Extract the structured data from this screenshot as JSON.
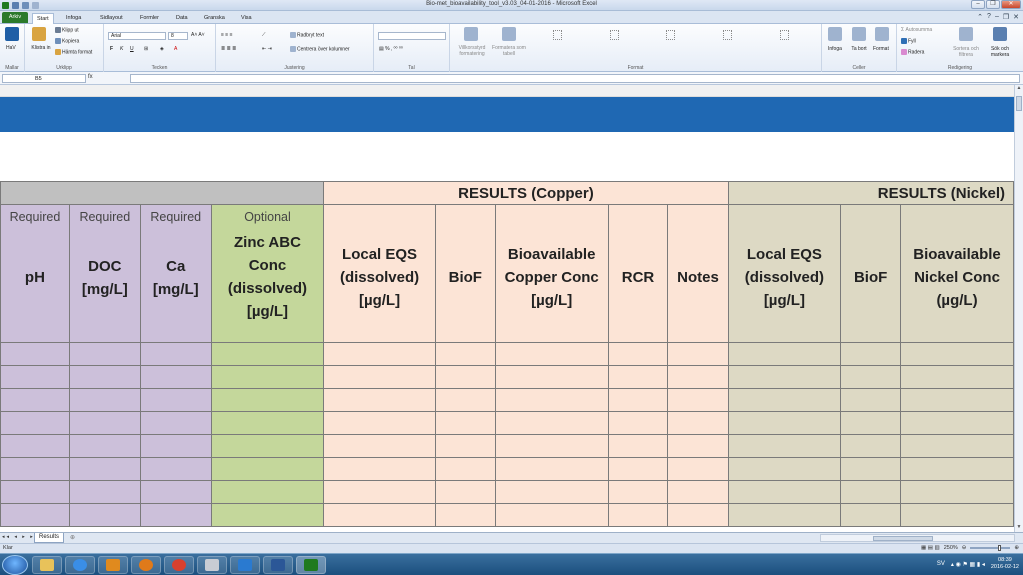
{
  "window": {
    "title": "Bio-met_bioavailability_tool_v3.03_04-01-2016 - Microsoft Excel"
  },
  "tabs": [
    {
      "label": "Arkiv"
    },
    {
      "label": "Start"
    },
    {
      "label": "Infoga"
    },
    {
      "label": "Sidlayout"
    },
    {
      "label": "Formler"
    },
    {
      "label": "Data"
    },
    {
      "label": "Granska"
    },
    {
      "label": "Visa"
    }
  ],
  "ribbon": {
    "mallar": {
      "label": "Mallar",
      "hav": "HaV"
    },
    "urklipp": {
      "label": "Urklipp",
      "klistra": "Klistra in",
      "klipp": "Klipp ut",
      "kopiera": "Kopiera",
      "hamta": "Hämta format"
    },
    "tecken": {
      "label": "Tecken",
      "font": "Arial",
      "size": "8"
    },
    "justering": {
      "label": "Justering",
      "radbryt": "Radbryt text",
      "centrera": "Centrera över kolumner"
    },
    "tal": {
      "label": "Tal"
    },
    "format_group": {
      "label": "Format",
      "villkor": "Villkorsstyrd formatering",
      "tabell": "Formatera som tabell"
    },
    "celler": {
      "label": "Celler",
      "infoga": "Infoga",
      "ta_bort": "Ta bort",
      "format": "Format"
    },
    "redigering": {
      "label": "Redigering",
      "autosumma": "Autosumma",
      "fyll": "Fyll",
      "radera": "Radera",
      "sortera": "Sortera och filtrera",
      "sok": "Sök och markera"
    }
  },
  "formula_bar": {
    "cell_ref": "B5",
    "fx": "fx",
    "value": ""
  },
  "sheet": {
    "group_headers": {
      "copper": "RESULTS (Copper)",
      "nickel": "RESULTS (Nickel)"
    },
    "columns": [
      {
        "tag": "Required",
        "header": "pH",
        "color": "purple"
      },
      {
        "tag": "Required",
        "header": "DOC\n[mg/L]",
        "color": "purple"
      },
      {
        "tag": "Required",
        "header": "Ca\n[mg/L]",
        "color": "purple"
      },
      {
        "tag": "Optional",
        "header": "Zinc ABC\nConc\n(dissolved)\n[µg/L]",
        "color": "green"
      },
      {
        "tag": "",
        "header": "Local EQS\n(dissolved)\n[µg/L]",
        "color": "peach"
      },
      {
        "tag": "",
        "header": "BioF",
        "color": "peach"
      },
      {
        "tag": "",
        "header": "Bioavailable\nCopper Conc\n[µg/L]",
        "color": "peach"
      },
      {
        "tag": "",
        "header": "RCR",
        "color": "peach"
      },
      {
        "tag": "",
        "header": "Notes",
        "color": "peach"
      },
      {
        "tag": "",
        "header": "Local EQS\n(dissolved)\n[µg/L]",
        "color": "tan"
      },
      {
        "tag": "",
        "header": "BioF",
        "color": "tan"
      },
      {
        "tag": "",
        "header": "Bioavailable\nNickel Conc\n(µg/L)",
        "color": "tan"
      }
    ],
    "data_rows": 8
  },
  "sheet_tabs": [
    {
      "label": "Results"
    }
  ],
  "status": {
    "text": "Klar",
    "zoom": "250%"
  },
  "taskbar": {
    "lang": "SV",
    "time": "08:39",
    "date": "2016-02-12"
  },
  "colors": {
    "banner": "#1f68b3",
    "purple": "#ccc0da",
    "green": "#c4d79b",
    "peach": "#fce4d6",
    "tan": "#ddd9c4"
  }
}
